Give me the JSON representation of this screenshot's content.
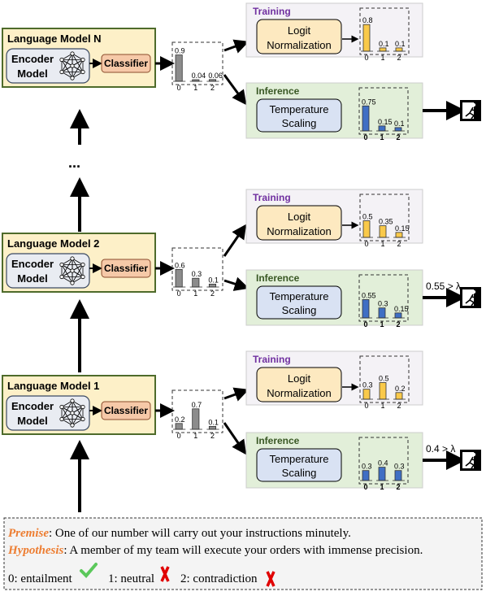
{
  "colors": {
    "source_bars": "#8c8c8c",
    "training_bars": "#f9c94a",
    "inference_bars": "#3f6fc4",
    "training_title": "#7030a0",
    "inference_title": "#385723",
    "lm_bg": "#fdf0c8",
    "lm_border": "#4e6b2b",
    "encoder_bg": "#e9ecf2",
    "classifier_bg": "#f6c9a8",
    "logit_bg": "#fde9c0",
    "temp_bg": "#d9e2f3",
    "training_bg": "#f4f2f6",
    "inference_bg": "#e2efd9",
    "premise_color": "#ed7d31",
    "check": "#5bc85b",
    "cross": "#e00000"
  },
  "labels": {
    "encoder_line1": "Encoder",
    "encoder_line2": "Model",
    "classifier": "Classifier",
    "training": "Training",
    "inference": "Inference",
    "logit_line1": "Logit",
    "logit_line2": "Normalization",
    "temp_line1": "Temperature",
    "temp_line2": "Scaling",
    "ellipsis": "..."
  },
  "groups": [
    {
      "title": "Language Model N",
      "categories": [
        "0",
        "1",
        "2"
      ],
      "classifier_output": [
        0.9,
        0.04,
        0.06
      ],
      "training_output": [
        0.8,
        0.1,
        0.1
      ],
      "inference_output": [
        0.75,
        0.15,
        0.1
      ],
      "exit_condition": "",
      "exit_icon": "exit-running-man-icon"
    },
    {
      "title": "Language Model 2",
      "categories": [
        "0",
        "1",
        "2"
      ],
      "classifier_output": [
        0.6,
        0.3,
        0.1
      ],
      "training_output": [
        0.5,
        0.35,
        0.15
      ],
      "inference_output": [
        0.55,
        0.3,
        0.15
      ],
      "exit_condition": "0.55 > λ",
      "exit_icon": "exit-running-man-icon"
    },
    {
      "title": "Language Model 1",
      "categories": [
        "0",
        "1",
        "2"
      ],
      "classifier_output": [
        0.2,
        0.7,
        0.1
      ],
      "training_output": [
        0.3,
        0.5,
        0.2
      ],
      "inference_output": [
        0.3,
        0.4,
        0.3
      ],
      "exit_condition": "0.4 > λ",
      "exit_icon": "exit-running-man-icon"
    }
  ],
  "example": {
    "premise_label": "Premise",
    "premise_text": ": One of our number will carry out your instructions minutely.",
    "hypothesis_label": "Hypothesis",
    "hypothesis_text": ": A member of my team will execute your orders with immense precision.",
    "classes": [
      {
        "label": "0: entailment",
        "mark": "check-icon"
      },
      {
        "label": "1: neutral",
        "mark": "cross-icon"
      },
      {
        "label": "2: contradiction",
        "mark": "cross-icon"
      }
    ]
  }
}
